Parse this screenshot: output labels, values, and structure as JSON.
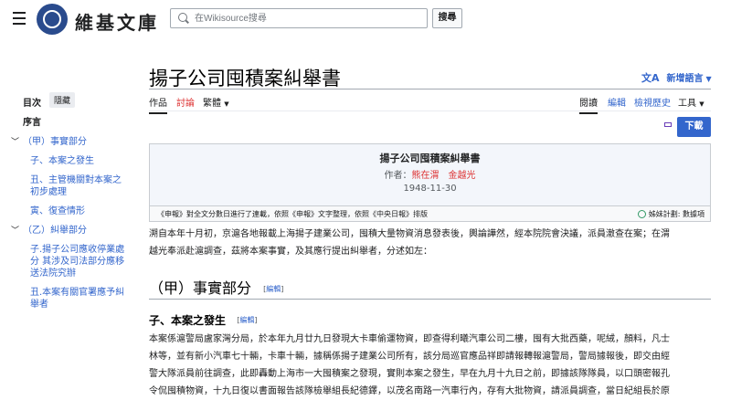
{
  "header": {
    "logo_text": "維基文庫",
    "search_placeholder": "在Wikisource搜尋",
    "search_button": "搜尋"
  },
  "page": {
    "title": "揚子公司囤積案糾舉書",
    "language_button": "新增語言"
  },
  "tabs": {
    "left": [
      "作品",
      "討論",
      "繁體"
    ],
    "right": [
      "閱讀",
      "編輯",
      "檢視歷史",
      "工具"
    ]
  },
  "sidebar": {
    "toc_heading": "目次",
    "hide_label": "隱藏",
    "items": [
      "序言",
      "（甲）事實部分",
      "子、本案之發生",
      "丑、主管機關對本案之",
      "初步處理",
      "寅、復查情形",
      "（乙）糾舉部分",
      "子.揚子公司應收停業處",
      "分 其涉及司法部分應移",
      "送法院究辦",
      "丑.本案有關官署應予糾",
      "舉者"
    ]
  },
  "download_button": "下載",
  "header_box": {
    "title": "揚子公司囤積案糾舉書",
    "author_label": "作者：",
    "authors": "熊在渭　金越光",
    "date": "1948-11-30"
  },
  "source_note": {
    "text": "《申報》對全文分數日進行了連載，依照《申報》文字整理，依照《中央日報》排版",
    "project": "姊妹計劃: 數據項"
  },
  "body": {
    "intro_1": "溯自本年十月初，京滬各地報載上海揚子建業公司，囤積大量物資消息發表後，輿論譁然，經本院院會決議，派員澈查在案；在渭",
    "intro_2": "越光奉派赴滬調查，茲將本案事實，及其應行提出糾舉者，分述如左：",
    "section_title": "（甲）事實部分",
    "edit_label": "編輯",
    "subsection_title": "子、本案之發生",
    "para_1": "本案係滬警局盧家灣分局，於本年九月廿九日發現大卡車偷運物資，即查得利曦汽車公司二樓，囤有大批西藥，呢絨，顏料，凡士",
    "para_2": "林等，並有新小汽車七十輛，卡車十輛，據稱係揚子建業公司所有，該分局巡官應品祥即請報轉報滬警局，警局據報後，即交由經",
    "para_3": "警大隊派員前往調查，此即轟動上海市一大囤積案之發現，實則本案之發生，早在九月十九日之前，即據該隊隊員，以口頭密報孔",
    "para_4": "令侃囤積物資，十九日復以書面報告該隊檢舉組長紀德鐸，以茂名南路一汽車行內，存有大批物資，請派員調查，當日紀組長於原"
  }
}
